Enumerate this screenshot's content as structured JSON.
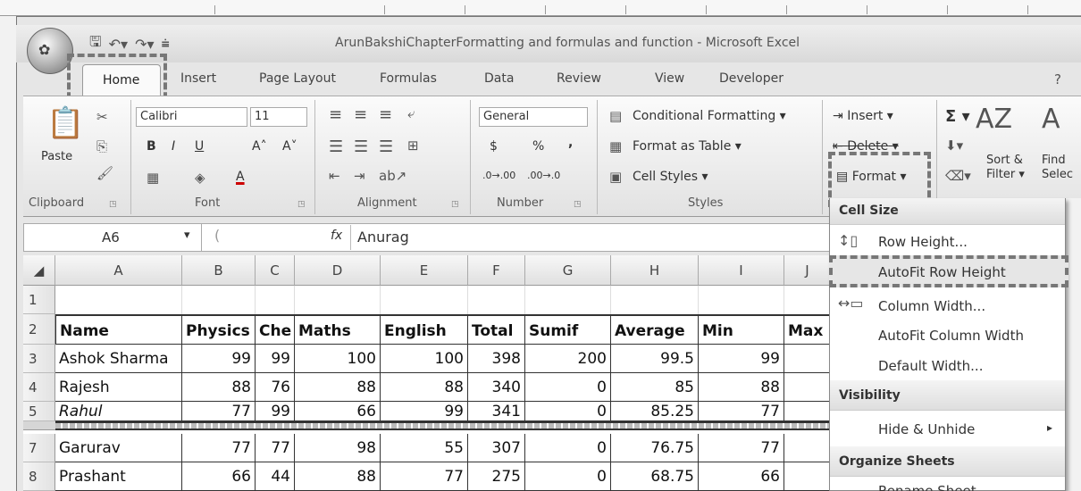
{
  "window": {
    "title": "ArunBakshiChapterFormatting and formulas and function - Microsoft Excel"
  },
  "tabs": [
    "Home",
    "Insert",
    "Page Layout",
    "Formulas",
    "Data",
    "Review",
    "View",
    "Developer"
  ],
  "ribbon": {
    "clipboard": {
      "label": "Clipboard",
      "paste": "Paste"
    },
    "font": {
      "label": "Font",
      "name": "Calibri",
      "size": "11"
    },
    "alignment": {
      "label": "Alignment"
    },
    "number": {
      "label": "Number",
      "format": "General",
      "currency": "$",
      "percent": "%",
      "comma": ","
    },
    "styles": {
      "label": "Styles",
      "conditional": "Conditional Formatting",
      "format_table": "Format as Table",
      "cell_styles": "Cell Styles"
    },
    "cells": {
      "insert": "Insert",
      "delete": "Delete",
      "format": "Format"
    },
    "editing": {
      "sort": "Sort &",
      "filter": "Filter",
      "find": "Find",
      "select": "Selec"
    }
  },
  "formula_bar": {
    "cell_ref": "A6",
    "fx": "fx",
    "value": "Anurag"
  },
  "columns": [
    "A",
    "B",
    "C",
    "D",
    "E",
    "F",
    "G",
    "H",
    "I",
    "J"
  ],
  "rows": [
    {
      "num": "1",
      "cells": [
        "",
        "",
        "",
        "",
        "",
        "",
        "",
        "",
        "",
        ""
      ]
    },
    {
      "num": "2",
      "cells": [
        "Name",
        "Physics",
        "Che",
        "Maths",
        "English",
        "Total",
        "Sumif",
        "Average",
        "Min",
        "Max"
      ]
    },
    {
      "num": "3",
      "cells": [
        "Ashok Sharma",
        "99",
        "99",
        "100",
        "100",
        "398",
        "200",
        "99.5",
        "99",
        ""
      ]
    },
    {
      "num": "4",
      "cells": [
        "Rajesh",
        "88",
        "76",
        "88",
        "88",
        "340",
        "0",
        "85",
        "88",
        ""
      ]
    },
    {
      "num": "5",
      "cells": [
        "Rahul",
        "77",
        "99",
        "66",
        "99",
        "341",
        "0",
        "85.25",
        "77",
        ""
      ]
    },
    {
      "num": "7",
      "cells": [
        "Garurav",
        "77",
        "77",
        "98",
        "55",
        "307",
        "0",
        "76.75",
        "77",
        ""
      ]
    },
    {
      "num": "8",
      "cells": [
        "Prashant",
        "66",
        "44",
        "88",
        "77",
        "275",
        "0",
        "68.75",
        "66",
        ""
      ]
    }
  ],
  "menu": {
    "sections": [
      "Cell Size",
      "Visibility",
      "Organize Sheets"
    ],
    "items": [
      "Row Height...",
      "AutoFit Row Height",
      "Column Width...",
      "AutoFit Column Width",
      "Default Width...",
      "Hide & Unhide",
      "Rename Sheet"
    ]
  }
}
